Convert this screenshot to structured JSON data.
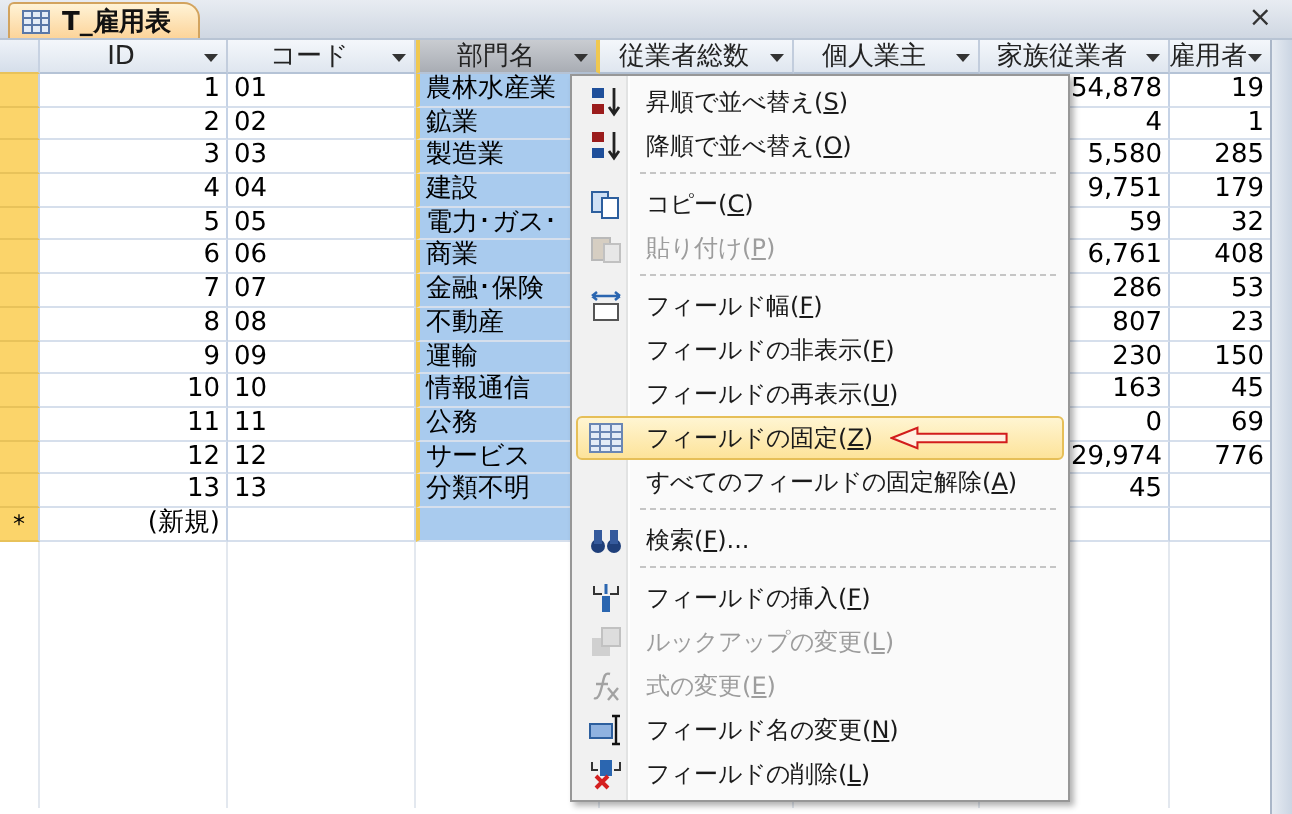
{
  "tab": {
    "title": "T_雇用表",
    "close": "×"
  },
  "columns": [
    {
      "label": "ID",
      "selected": false
    },
    {
      "label": "コード",
      "selected": false
    },
    {
      "label": "部門名",
      "selected": true
    },
    {
      "label": "従業者総数",
      "selected": false
    },
    {
      "label": "個人業主",
      "selected": false
    },
    {
      "label": "家族従業者",
      "selected": false
    },
    {
      "label": "雇用者",
      "selected": false
    }
  ],
  "rows": [
    {
      "cells": [
        "1",
        "01",
        "農林水産業",
        "",
        "",
        "54,878",
        "19"
      ]
    },
    {
      "cells": [
        "2",
        "02",
        "鉱業",
        "",
        "",
        "4",
        "1"
      ]
    },
    {
      "cells": [
        "3",
        "03",
        "製造業",
        "",
        "",
        "5,580",
        "285"
      ]
    },
    {
      "cells": [
        "4",
        "04",
        "建設",
        "",
        "",
        "9,751",
        "179"
      ]
    },
    {
      "cells": [
        "5",
        "05",
        "電力･ガス･",
        "",
        "",
        "59",
        "32"
      ]
    },
    {
      "cells": [
        "6",
        "06",
        "商業",
        "",
        "",
        "6,761",
        "408"
      ]
    },
    {
      "cells": [
        "7",
        "07",
        "金融･保険",
        "",
        "",
        "286",
        "53"
      ]
    },
    {
      "cells": [
        "8",
        "08",
        "不動産",
        "",
        "",
        "807",
        "23"
      ]
    },
    {
      "cells": [
        "9",
        "09",
        "運輸",
        "",
        "",
        "230",
        "150"
      ]
    },
    {
      "cells": [
        "10",
        "10",
        "情報通信",
        "",
        "",
        "163",
        "45"
      ]
    },
    {
      "cells": [
        "11",
        "11",
        "公務",
        "",
        "",
        "0",
        "69"
      ]
    },
    {
      "cells": [
        "12",
        "12",
        "サービス",
        "",
        "",
        "29,974",
        "776"
      ]
    },
    {
      "cells": [
        "13",
        "13",
        "分類不明",
        "",
        "",
        "45",
        ""
      ]
    }
  ],
  "new_row": {
    "marker": "*",
    "label": "(新規)"
  },
  "context_menu": [
    {
      "kind": "item",
      "label": "昇順で並べ替え(S)",
      "disabled": false,
      "selected": false
    },
    {
      "kind": "item",
      "label": "降順で並べ替え(O)",
      "disabled": false,
      "selected": false
    },
    {
      "kind": "separator"
    },
    {
      "kind": "item",
      "label": "コピー(C)",
      "disabled": false,
      "selected": false
    },
    {
      "kind": "item",
      "label": "貼り付け(P)",
      "disabled": true,
      "selected": false
    },
    {
      "kind": "separator"
    },
    {
      "kind": "item",
      "label": "フィールド幅(F)",
      "disabled": false,
      "selected": false
    },
    {
      "kind": "item",
      "label": "フィールドの非表示(F)",
      "disabled": false,
      "selected": false
    },
    {
      "kind": "item",
      "label": "フィールドの再表示(U)",
      "disabled": false,
      "selected": false
    },
    {
      "kind": "item",
      "label": "フィールドの固定(Z)",
      "disabled": false,
      "selected": true
    },
    {
      "kind": "item",
      "label": "すべてのフィールドの固定解除(A)",
      "disabled": false,
      "selected": false
    },
    {
      "kind": "separator"
    },
    {
      "kind": "item",
      "label": "検索(F)...",
      "disabled": false,
      "selected": false
    },
    {
      "kind": "separator"
    },
    {
      "kind": "item",
      "label": "フィールドの挿入(F)",
      "disabled": false,
      "selected": false
    },
    {
      "kind": "item",
      "label": "ルックアップの変更(L)",
      "disabled": true,
      "selected": false
    },
    {
      "kind": "item",
      "label": "式の変更(E)",
      "disabled": true,
      "selected": false
    },
    {
      "kind": "item",
      "label": "フィールド名の変更(N)",
      "disabled": false,
      "selected": false
    },
    {
      "kind": "item",
      "label": "フィールドの削除(L)",
      "disabled": false,
      "selected": false
    }
  ]
}
